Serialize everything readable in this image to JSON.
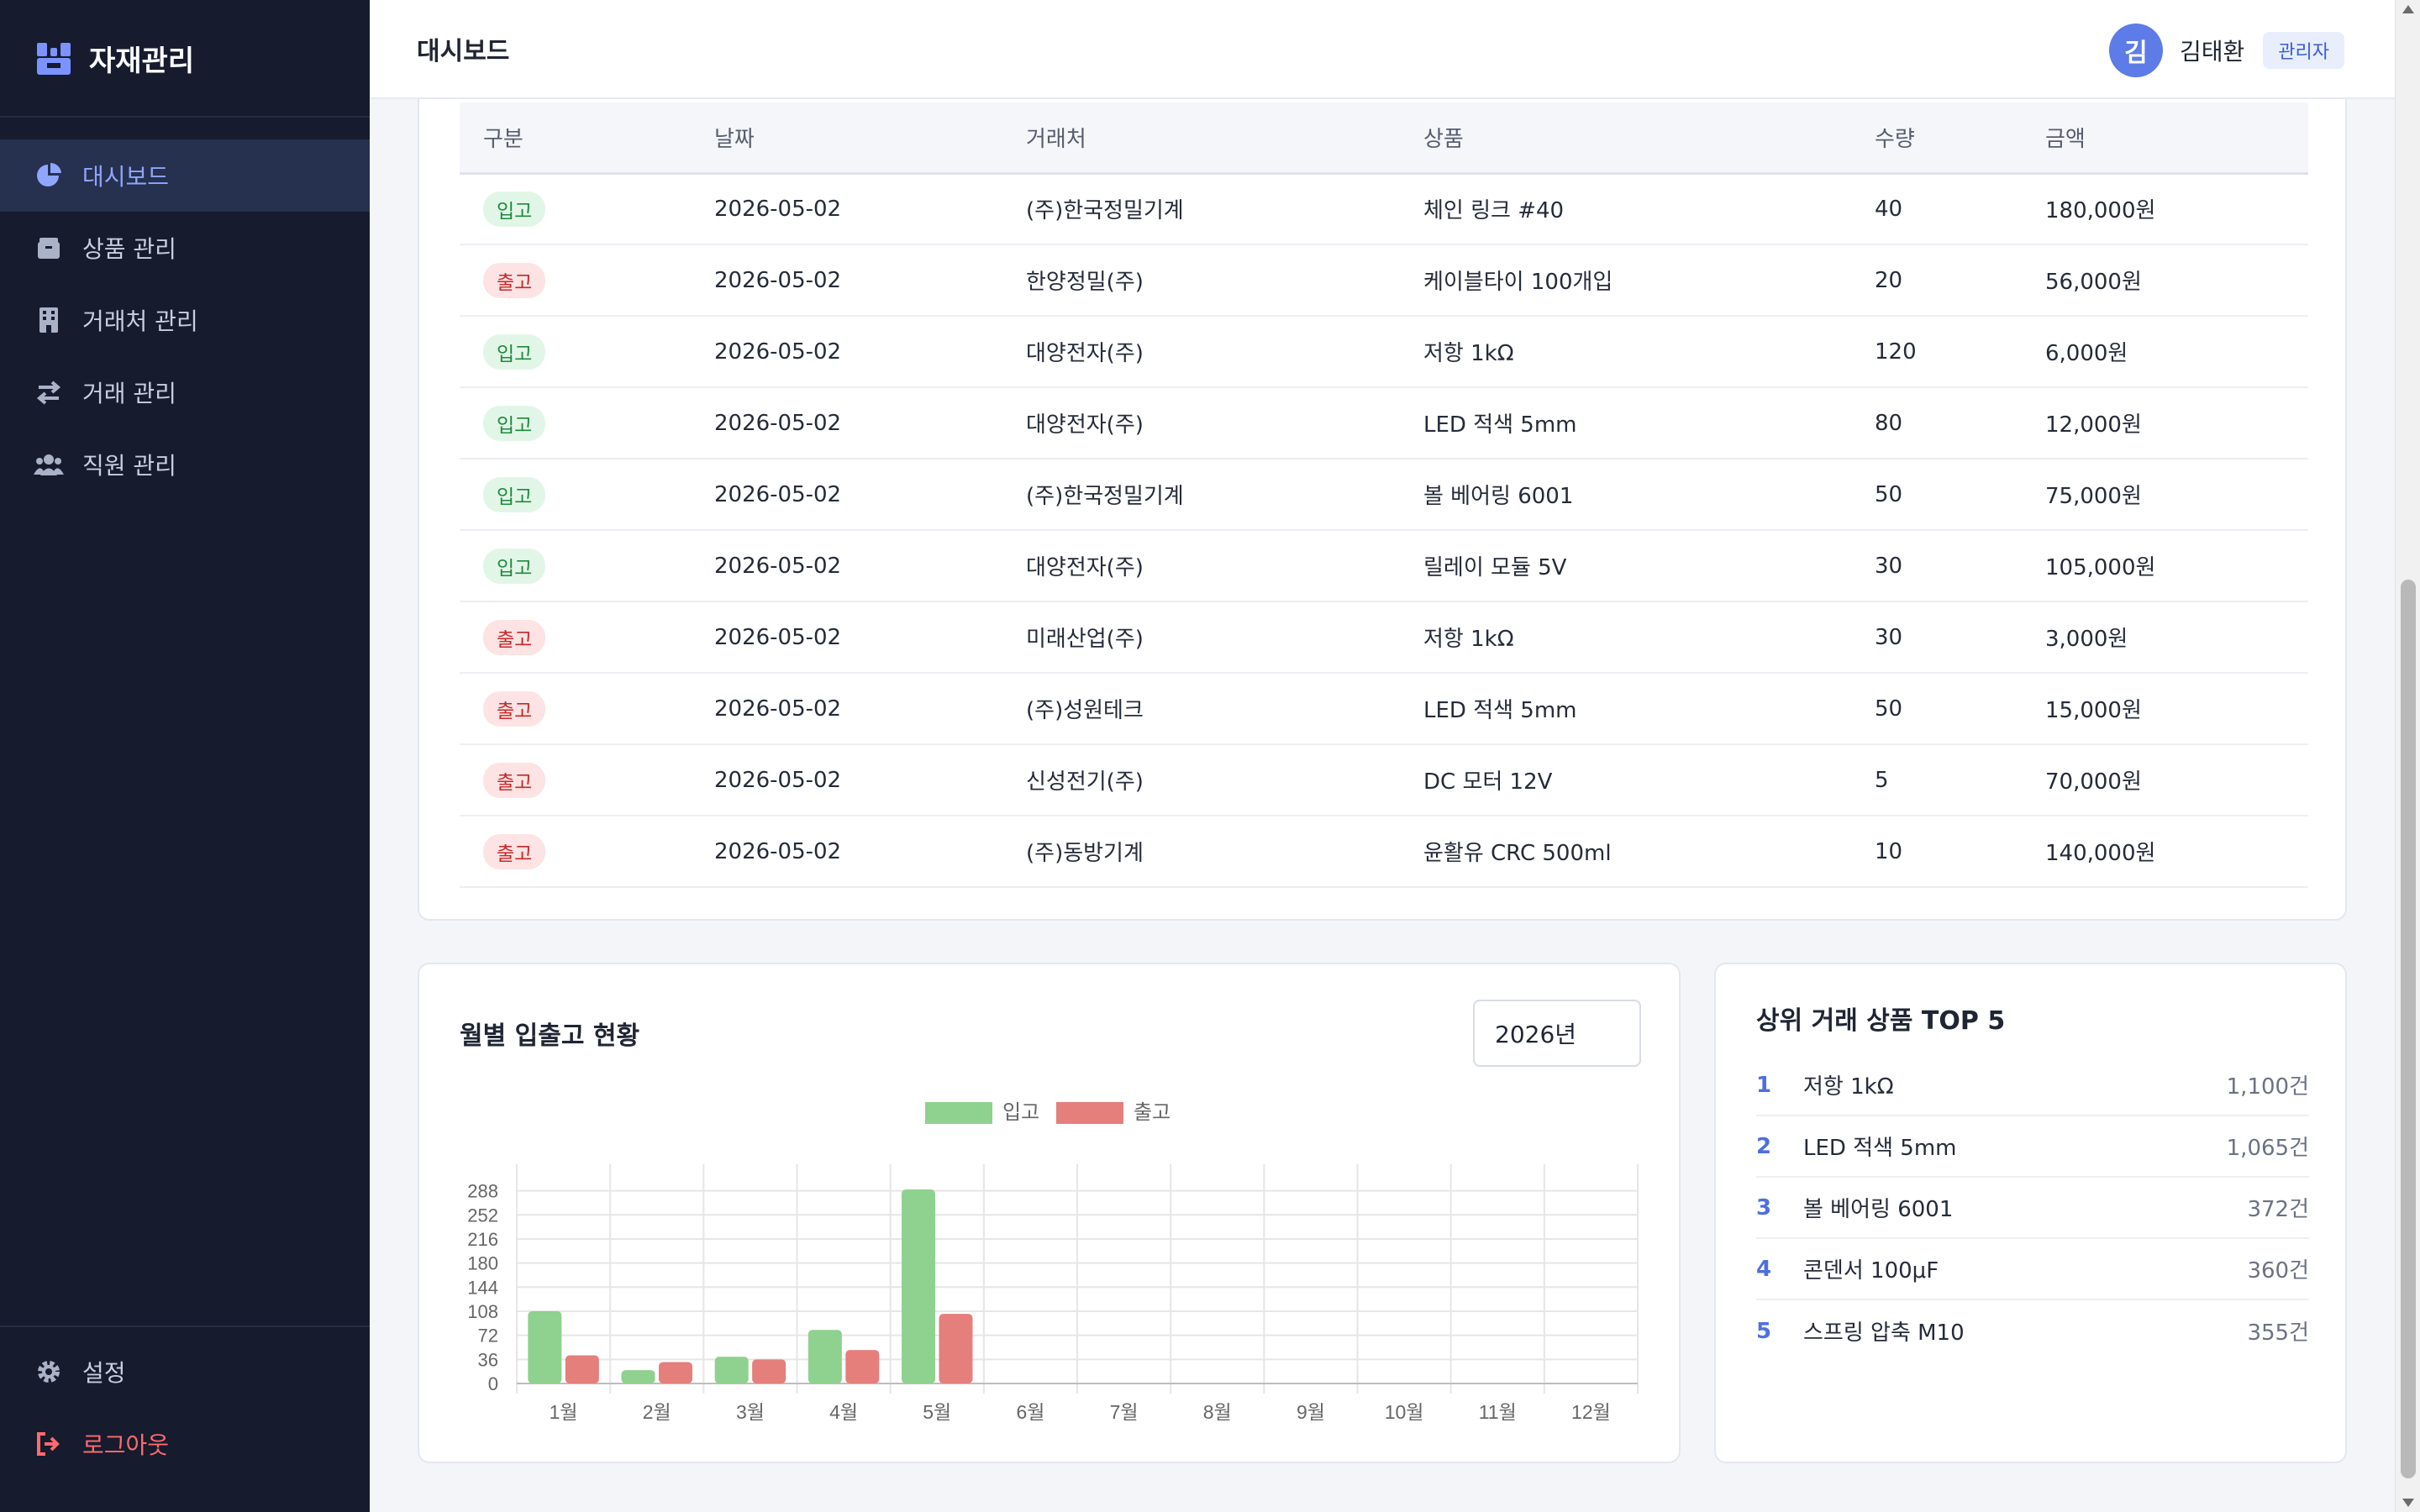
{
  "app": {
    "title": "자재관리"
  },
  "sidebar": {
    "items": [
      {
        "label": "대시보드",
        "icon": "pie-chart-icon",
        "active": true
      },
      {
        "label": "상품 관리",
        "icon": "box-icon",
        "active": false
      },
      {
        "label": "거래처 관리",
        "icon": "building-icon",
        "active": false
      },
      {
        "label": "거래 관리",
        "icon": "exchange-arrows-icon",
        "active": false
      },
      {
        "label": "직원 관리",
        "icon": "users-icon",
        "active": false
      }
    ],
    "settings_label": "설정",
    "logout_label": "로그아웃"
  },
  "header": {
    "title": "대시보드"
  },
  "user": {
    "avatar_initial": "김",
    "name": "김태환",
    "role": "관리자"
  },
  "transactions": {
    "columns": [
      "구분",
      "날짜",
      "거래처",
      "상품",
      "수량",
      "금액"
    ],
    "rows": [
      {
        "type": "입고",
        "date": "2026-05-02",
        "partner": "(주)한국정밀기계",
        "product": "체인 링크 #40",
        "qty": "40",
        "amount": "180,000원"
      },
      {
        "type": "출고",
        "date": "2026-05-02",
        "partner": "한양정밀(주)",
        "product": "케이블타이 100개입",
        "qty": "20",
        "amount": "56,000원"
      },
      {
        "type": "입고",
        "date": "2026-05-02",
        "partner": "대양전자(주)",
        "product": "저항 1kΩ",
        "qty": "120",
        "amount": "6,000원"
      },
      {
        "type": "입고",
        "date": "2026-05-02",
        "partner": "대양전자(주)",
        "product": "LED 적색 5mm",
        "qty": "80",
        "amount": "12,000원"
      },
      {
        "type": "입고",
        "date": "2026-05-02",
        "partner": "(주)한국정밀기계",
        "product": "볼 베어링 6001",
        "qty": "50",
        "amount": "75,000원"
      },
      {
        "type": "입고",
        "date": "2026-05-02",
        "partner": "대양전자(주)",
        "product": "릴레이 모듈 5V",
        "qty": "30",
        "amount": "105,000원"
      },
      {
        "type": "출고",
        "date": "2026-05-02",
        "partner": "미래산업(주)",
        "product": "저항 1kΩ",
        "qty": "30",
        "amount": "3,000원"
      },
      {
        "type": "출고",
        "date": "2026-05-02",
        "partner": "(주)성원테크",
        "product": "LED 적색 5mm",
        "qty": "50",
        "amount": "15,000원"
      },
      {
        "type": "출고",
        "date": "2026-05-02",
        "partner": "신성전기(주)",
        "product": "DC 모터 12V",
        "qty": "5",
        "amount": "70,000원"
      },
      {
        "type": "출고",
        "date": "2026-05-02",
        "partner": "(주)동방기계",
        "product": "윤활유 CRC 500ml",
        "qty": "10",
        "amount": "140,000원"
      }
    ]
  },
  "monthly": {
    "title": "월별 입출고 현황",
    "year": "2026년"
  },
  "chart_data": {
    "type": "bar",
    "categories": [
      "1월",
      "2월",
      "3월",
      "4월",
      "5월",
      "6월",
      "7월",
      "8월",
      "9월",
      "10월",
      "11월",
      "12월"
    ],
    "series": [
      {
        "name": "입고",
        "color": "#8fd18f",
        "values": [
          108,
          20,
          40,
          80,
          290,
          0,
          0,
          0,
          0,
          0,
          0,
          0
        ]
      },
      {
        "name": "출고",
        "color": "#e57f7c",
        "values": [
          42,
          32,
          36,
          50,
          104,
          0,
          0,
          0,
          0,
          0,
          0,
          0
        ]
      }
    ],
    "yticks": [
      0,
      36,
      72,
      108,
      144,
      180,
      216,
      252,
      288
    ],
    "ylim": [
      0,
      290
    ],
    "legend_position": "top",
    "grid": true
  },
  "top5": {
    "title": "상위 거래 상품 TOP 5",
    "items": [
      {
        "rank": "1",
        "name": "저항 1kΩ",
        "count": "1,100건"
      },
      {
        "rank": "2",
        "name": "LED 적색 5mm",
        "count": "1,065건"
      },
      {
        "rank": "3",
        "name": "볼 베어링 6001",
        "count": "372건"
      },
      {
        "rank": "4",
        "name": "콘덴서 100μF",
        "count": "360건"
      },
      {
        "rank": "5",
        "name": "스프링 압축 M10",
        "count": "355건"
      }
    ]
  }
}
